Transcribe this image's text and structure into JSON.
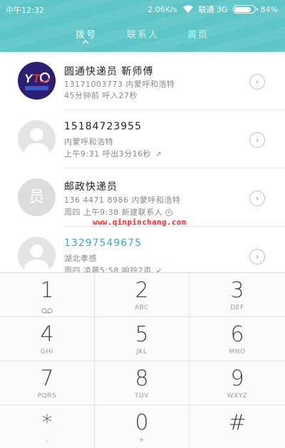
{
  "status_bar": {
    "time": "中午12:32",
    "net_speed": "2.06K/s",
    "carrier": "联通 3G",
    "battery_percent": "84%",
    "battery_level": 0.84
  },
  "tabs": [
    {
      "label": "拨号",
      "active": true
    },
    {
      "label": "联系人",
      "active": false
    },
    {
      "label": "黄页",
      "active": false
    }
  ],
  "call_log": [
    {
      "avatar": "yto-logo",
      "avatar_text": "",
      "name": "圆通快递员 靳师傅",
      "line1": "13171003773 内蒙呼和浩特",
      "line2": "45分钟前 呼入27秒",
      "line2_icon": ""
    },
    {
      "avatar": "default",
      "avatar_text": "",
      "name": "15184723955",
      "line1": "内蒙呼和浩特",
      "line2": "上午9:31 呼出3分16秒",
      "line2_icon": "↗"
    },
    {
      "avatar": "text",
      "avatar_text": "员",
      "name": "邮政快递员",
      "line1": "136 4471 8986 内蒙呼和浩特",
      "line2": "周四 上午9:38 新建联系人",
      "line2_icon": "+"
    },
    {
      "avatar": "default",
      "avatar_text": "",
      "name": "13297549675",
      "line1": "湖北孝感",
      "line2": "周四 凌晨5:58 响铃2声",
      "line2_icon": "↙"
    }
  ],
  "watermark": "www.qinpinchang.com",
  "keypad": [
    {
      "digit": "1",
      "letters": "",
      "sub_icon": "voicemail-icon"
    },
    {
      "digit": "2",
      "letters": "ABC"
    },
    {
      "digit": "3",
      "letters": "DEF"
    },
    {
      "digit": "4",
      "letters": "GHI"
    },
    {
      "digit": "5",
      "letters": "JKL"
    },
    {
      "digit": "6",
      "letters": "MNO"
    },
    {
      "digit": "7",
      "letters": "PQRS"
    },
    {
      "digit": "8",
      "letters": "TUV"
    },
    {
      "digit": "9",
      "letters": "WXYZ"
    },
    {
      "digit": "*",
      "letters": ","
    },
    {
      "digit": "0",
      "letters": "+"
    },
    {
      "digit": "#",
      "letters": ""
    }
  ],
  "colors": {
    "header": "#5ec6c9",
    "missed": "#e04a3a",
    "link_blue": "#3aa8cf"
  }
}
